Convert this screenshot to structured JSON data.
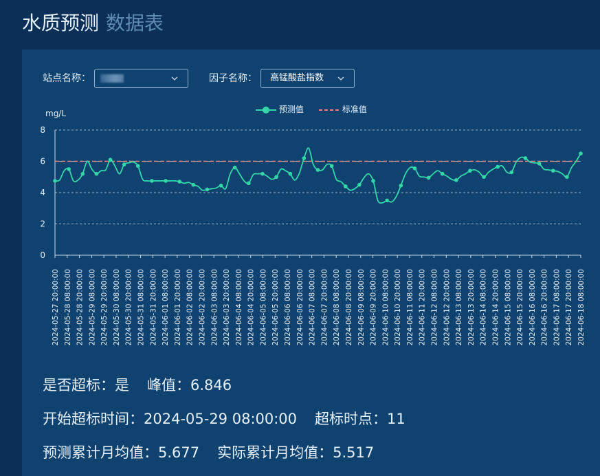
{
  "header": {
    "title": "水质预测",
    "subtitle": "数据表"
  },
  "filters": {
    "station_label": "站点名称：",
    "station_value": "",
    "factor_label": "因子名称：",
    "factor_value": "高锰酸盐指数"
  },
  "colors": {
    "prediction": "#34d7a8",
    "standard": "#e8877e",
    "background": "#0f426f"
  },
  "chart_data": {
    "type": "line",
    "ylabel": "mg/L",
    "ylim": [
      0,
      8
    ],
    "yticks": [
      "0",
      "2",
      "4",
      "6",
      "8"
    ],
    "legend": [
      "预测值",
      "标准值"
    ],
    "x_tick_labels": [
      "2024-05-27 20:00:00",
      "2024-05-28 08:00:00",
      "2024-05-28 20:00:00",
      "2024-05-29 08:00:00",
      "2024-05-29 20:00:00",
      "2024-05-30 08:00:00",
      "2024-05-30 20:00:00",
      "2024-05-31 08:00:00",
      "2024-05-31 20:00:00",
      "2024-06-01 08:00:00",
      "2024-06-01 20:00:00",
      "2024-06-02 08:00:00",
      "2024-06-02 20:00:00",
      "2024-06-03 08:00:00",
      "2024-06-03 20:00:00",
      "2024-06-04 08:00:00",
      "2024-06-04 20:00:00",
      "2024-06-05 08:00:00",
      "2024-06-05 20:00:00",
      "2024-06-06 08:00:00",
      "2024-06-06 20:00:00",
      "2024-06-07 08:00:00",
      "2024-06-07 20:00:00",
      "2024-06-08 08:00:00",
      "2024-06-08 20:00:00",
      "2024-06-09 08:00:00",
      "2024-06-09 20:00:00",
      "2024-06-10 08:00:00",
      "2024-06-10 20:00:00",
      "2024-06-11 08:00:00",
      "2024-06-11 20:00:00",
      "2024-06-12 08:00:00",
      "2024-06-12 20:00:00",
      "2024-06-13 08:00:00",
      "2024-06-13 20:00:00",
      "2024-06-14 08:00:00",
      "2024-06-14 20:00:00",
      "2024-06-15 08:00:00",
      "2024-06-15 20:00:00",
      "2024-06-16 08:00:00",
      "2024-06-16 20:00:00",
      "2024-06-17 08:00:00",
      "2024-06-17 20:00:00",
      "2024-06-18 08:00:00"
    ],
    "series": [
      {
        "name": "预测值",
        "values": [
          4.75,
          4.8,
          5.4,
          5.5,
          4.75,
          4.8,
          5.2,
          6.0,
          5.5,
          5.2,
          5.4,
          5.45,
          6.1,
          5.7,
          5.2,
          5.8,
          5.9,
          5.95,
          5.7,
          4.85,
          4.75,
          4.75,
          4.75,
          4.75,
          4.75,
          4.75,
          4.75,
          4.7,
          4.6,
          4.65,
          4.5,
          4.4,
          4.15,
          4.2,
          4.25,
          4.3,
          4.45,
          4.25,
          5.2,
          5.6,
          5.2,
          4.75,
          4.6,
          5.15,
          5.2,
          5.2,
          5.05,
          4.85,
          5.0,
          5.5,
          5.4,
          5.2,
          4.8,
          5.25,
          6.2,
          6.846,
          5.8,
          5.45,
          5.45,
          5.8,
          5.7,
          4.85,
          4.7,
          4.4,
          4.15,
          4.25,
          4.5,
          4.95,
          5.2,
          4.75,
          3.5,
          3.35,
          3.5,
          3.4,
          3.75,
          4.45,
          5.2,
          5.6,
          5.55,
          5.05,
          5.0,
          4.95,
          5.2,
          5.4,
          5.2,
          5.05,
          4.85,
          4.8,
          5.05,
          5.2,
          5.4,
          5.45,
          5.3,
          5.0,
          5.3,
          5.5,
          5.65,
          5.7,
          5.3,
          5.3,
          5.95,
          6.25,
          6.2,
          5.95,
          5.9,
          5.85,
          5.5,
          5.45,
          5.4,
          5.35,
          5.2,
          5.0,
          5.6,
          6.0,
          6.5
        ]
      },
      {
        "name": "标准值",
        "values": [
          6,
          6
        ]
      }
    ]
  },
  "stats": {
    "exceed_label": "是否超标：",
    "exceed_value": "是",
    "peak_label": "峰值：",
    "peak_value": "6.846",
    "start_label": "开始超标时间：",
    "start_value": "2024-05-29 08:00:00",
    "count_label": "超标时点：",
    "count_value": "11",
    "pred_avg_label": "预测累计月均值：",
    "pred_avg_value": "5.677",
    "actual_avg_label": "实际累计月均值：",
    "actual_avg_value": "5.517"
  }
}
